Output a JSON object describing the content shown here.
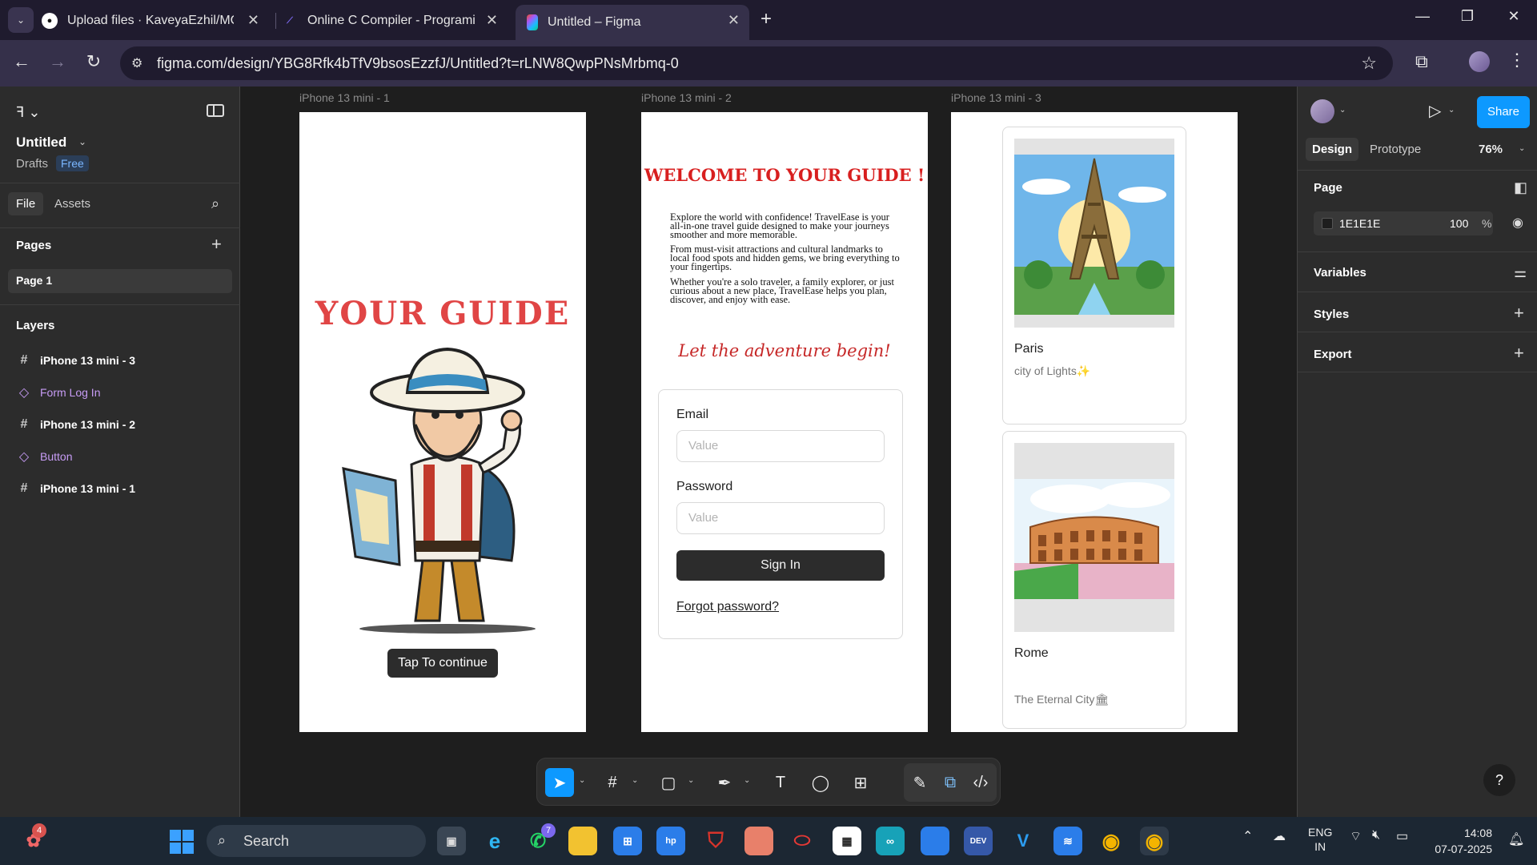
{
  "browser": {
    "tabs": [
      {
        "title": "Upload files · KaveyaEzhil/MC-S",
        "favicon": "github-icon"
      },
      {
        "title": "Online C Compiler - Programiz",
        "favicon": "programiz-icon"
      },
      {
        "title": "Untitled – Figma",
        "favicon": "figma-icon",
        "active": true
      }
    ],
    "url": "figma.com/design/YBG8Rfk4bTfV9bsosEzzfJ/Untitled?t=rLNW8QwpPNsMrbmq-0"
  },
  "left_panel": {
    "file_name": "Untitled",
    "location": "Drafts",
    "plan_badge": "Free",
    "tabs": {
      "file": "File",
      "assets": "Assets"
    },
    "pages_title": "Pages",
    "pages": [
      "Page 1"
    ],
    "layers_title": "Layers",
    "layers": [
      {
        "name": "iPhone 13 mini - 3",
        "type": "frame"
      },
      {
        "name": "Form Log In",
        "type": "component"
      },
      {
        "name": "iPhone 13 mini - 2",
        "type": "frame"
      },
      {
        "name": "Button",
        "type": "component"
      },
      {
        "name": "iPhone 13 mini - 1",
        "type": "frame"
      }
    ]
  },
  "canvas": {
    "frames": [
      {
        "label": "iPhone 13 mini - 1"
      },
      {
        "label": "iPhone 13 mini - 2"
      },
      {
        "label": "iPhone 13 mini - 3"
      }
    ],
    "frame1": {
      "title": "YOUR GUIDE",
      "button": "Tap To continue"
    },
    "frame2": {
      "heading": "WELCOME TO YOUR GUIDE !",
      "para1": "Explore the world with confidence! TravelEase is your all-in-one travel guide designed to make your journeys smoother and more memorable.",
      "para2": "From must-visit attractions and cultural landmarks to local food spots and hidden gems, we bring everything to your fingertips.",
      "para3": "Whether you're a solo traveler, a family explorer, or just curious about a new place, TravelEase helps you plan, discover, and enjoy with ease.",
      "tagline": "Let the adventure begin!",
      "email_label": "Email",
      "email_placeholder": "Value",
      "password_label": "Password",
      "password_placeholder": "Value",
      "signin": "Sign In",
      "forgot": "Forgot password?"
    },
    "frame3": {
      "cards": [
        {
          "title": "Paris",
          "subtitle": "city of Lights✨"
        },
        {
          "title": "Rome",
          "subtitle": "The Eternal City🏛"
        }
      ]
    }
  },
  "right_panel": {
    "share": "Share",
    "tabs": {
      "design": "Design",
      "prototype": "Prototype"
    },
    "zoom": "76%",
    "page_title": "Page",
    "page_color": "1E1E1E",
    "page_opacity": "100",
    "page_opacity_unit": "%",
    "variables": "Variables",
    "styles": "Styles",
    "export": "Export",
    "help": "?"
  },
  "taskbar": {
    "search": "Search",
    "lang_line1": "ENG",
    "lang_line2": "IN",
    "time": "14:08",
    "date": "07-07-2025",
    "whatsapp_badge": "7",
    "app_badge": "4"
  },
  "colors": {
    "figma_blue": "#0d99ff",
    "canvas_bg": "#1e1e1e",
    "title_red": "#d81f1f",
    "component_purple": "#c79cf5"
  }
}
